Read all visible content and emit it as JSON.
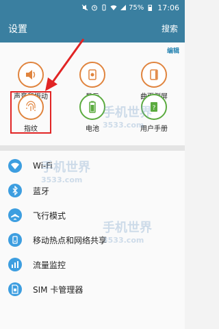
{
  "status_bar": {
    "battery_percent": "75%",
    "time": "17:06",
    "icons": [
      "mute-icon",
      "alarm-icon",
      "vibrate-icon",
      "wifi-icon",
      "signal-icon",
      "battery-icon"
    ]
  },
  "app_bar": {
    "title": "设置",
    "search_label": "搜索"
  },
  "quick_settings": {
    "edit_label": "编辑",
    "tiles": [
      {
        "label": "声音和振动",
        "icon": "speaker-icon"
      },
      {
        "label": "显示",
        "icon": "display-icon"
      },
      {
        "label": "曲面侧屏",
        "icon": "edge-screen-icon"
      },
      {
        "label": "指纹",
        "icon": "fingerprint-icon"
      },
      {
        "label": "电池",
        "icon": "battery-icon"
      },
      {
        "label": "用户手册",
        "icon": "help-book-icon"
      }
    ]
  },
  "settings_list": [
    {
      "label": "Wi-Fi",
      "icon": "wifi-icon"
    },
    {
      "label": "蓝牙",
      "icon": "bluetooth-icon"
    },
    {
      "label": "飞行模式",
      "icon": "airplane-icon"
    },
    {
      "label": "移动热点和网络共享",
      "icon": "hotspot-icon"
    },
    {
      "label": "流量监控",
      "icon": "data-usage-icon"
    },
    {
      "label": "SIM 卡管理器",
      "icon": "sim-card-icon"
    }
  ],
  "watermark": {
    "brand": "手机世界",
    "sub": "3533.com"
  },
  "colors": {
    "app_bar": "#3a7fa0",
    "accent_orange": "#e0843e",
    "accent_green": "#5bab3f",
    "list_icon_blue": "#3d9ee0",
    "highlight_red": "#e12424"
  }
}
